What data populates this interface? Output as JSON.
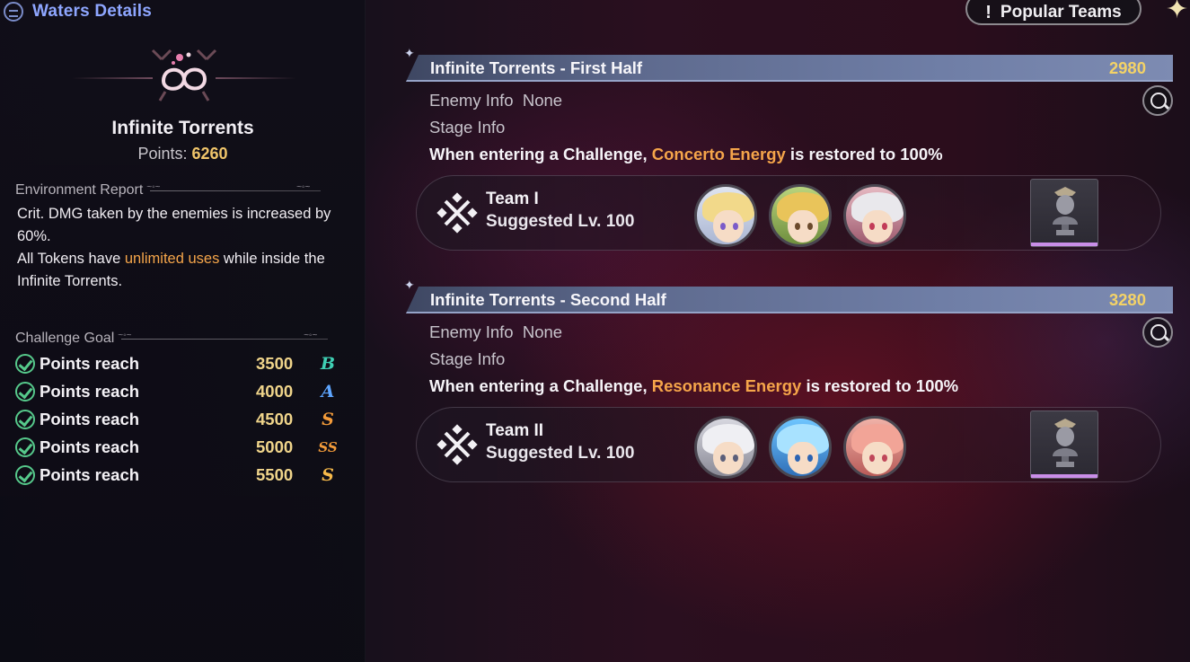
{
  "header": {
    "title": "Waters Details"
  },
  "realm": {
    "name": "Infinite Torrents",
    "points_label": "Points:",
    "points_value": "6260"
  },
  "environment": {
    "title": "Environment Report",
    "line1": "Crit. DMG taken by the enemies is increased by 60%.",
    "line2_pre": "All Tokens have ",
    "line2_hl": "unlimited uses",
    "line2_post": " while inside the Infinite Torrents."
  },
  "challenge_goal": {
    "title": "Challenge Goal",
    "goals": [
      {
        "label": "Points reach",
        "value": "3500",
        "rank": "B",
        "rank_color": "#3fd0b4"
      },
      {
        "label": "Points reach",
        "value": "4000",
        "rank": "A",
        "rank_color": "#5ea6ff"
      },
      {
        "label": "Points reach",
        "value": "4500",
        "rank": "S",
        "rank_color": "#f39b3a"
      },
      {
        "label": "Points reach",
        "value": "5000",
        "rank": "SS",
        "rank_color": "#f39b3a"
      },
      {
        "label": "Points reach",
        "value": "5500",
        "rank": "S",
        "rank_color": "#f6b94a"
      }
    ]
  },
  "popular_teams": {
    "icon": "!",
    "label": "Popular Teams"
  },
  "halves": [
    {
      "name": "Infinite Torrents - First Half",
      "score": "2980",
      "enemy_info_label": "Enemy Info",
      "enemy_info_value": "None",
      "stage_info_label": "Stage Info",
      "stage_desc_pre": "When entering a Challenge, ",
      "stage_desc_hl": "Concerto Energy",
      "stage_desc_post": " is restored to 100%",
      "team_name": "Team I",
      "team_level": "Suggested Lv. 100"
    },
    {
      "name": "Infinite Torrents - Second Half",
      "score": "3280",
      "enemy_info_label": "Enemy Info",
      "enemy_info_value": "None",
      "stage_info_label": "Stage Info",
      "stage_desc_pre": "When entering a Challenge, ",
      "stage_desc_hl": "Resonance Energy",
      "stage_desc_post": " is restored to 100%",
      "team_name": "Team II",
      "team_level": "Suggested Lv. 100"
    }
  ],
  "colors": {
    "accent_gold": "#f0c56a",
    "highlight_orange": "#f5a54a",
    "title_blue": "#8ea6ff"
  }
}
